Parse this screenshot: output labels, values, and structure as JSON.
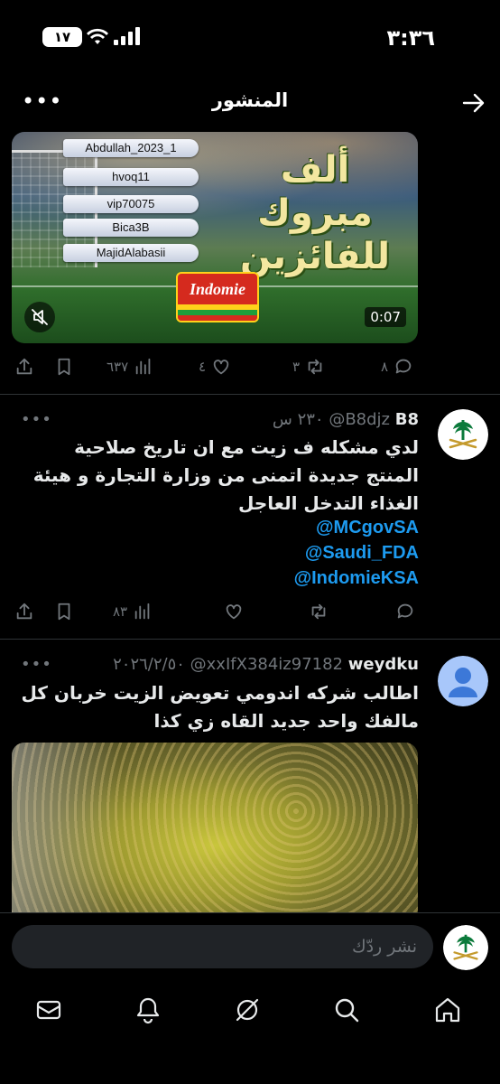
{
  "status": {
    "time": "٣:٣٦",
    "battery": "١٧"
  },
  "header": {
    "title": "المنشور"
  },
  "video": {
    "winners": [
      "Abdullah_2023_1",
      "hvoq11",
      "vip70075",
      "Bica3B",
      "MajidAlabasii"
    ],
    "promo_text": "ألف مبروك للفائزين",
    "brand": "Indomie",
    "duration": "0:07"
  },
  "main_actions": {
    "replies": "٨",
    "reposts": "٣",
    "likes": "٤",
    "views": "٦٣٧"
  },
  "tweets": [
    {
      "name": "B8",
      "handle": "@B8djz",
      "time": "٢٣٠ س",
      "text": "لدي مشكله ف زيت مع ان تاريخ صلاحية المنتج جديدة اتمنى من وزارة التجارة  و هيئة الغذاء التدخل العاجل",
      "mentions": [
        "@MCgovSA",
        "@Saudi_FDA",
        "@IndomieKSA"
      ],
      "views": "٨٣"
    },
    {
      "name": "weydku",
      "handle": "@xxIfX384iz97182",
      "time": "٢٠٢٦/٢/٥٠",
      "text": "اطالب شركه اندومي تعويض الزيت خربان كل مالفك واحد جديد القاه زي كذا"
    }
  ],
  "reply": {
    "placeholder": "نشر ردّك"
  },
  "colors": {
    "accent": "#1d9bf0",
    "muted": "#71767b",
    "background": "#000000"
  }
}
